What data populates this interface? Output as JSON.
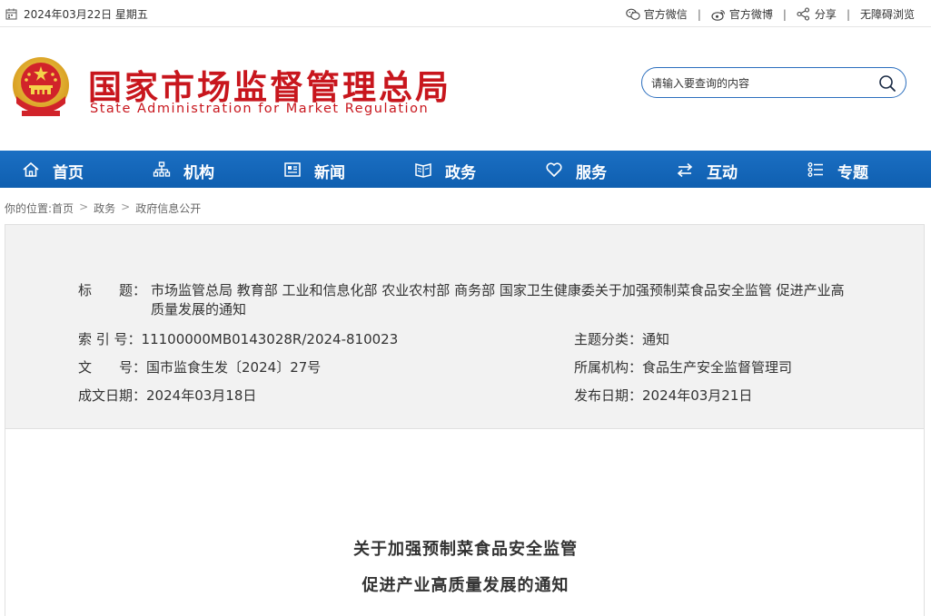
{
  "topbar": {
    "date": "2024年03月22日 星期五",
    "links": [
      {
        "label": "官方微信",
        "icon": "wechat-icon"
      },
      {
        "label": "官方微博",
        "icon": "weibo-icon"
      },
      {
        "label": "分享",
        "icon": "share-icon"
      },
      {
        "label": "无障碍浏览",
        "icon": ""
      }
    ],
    "separator": "|"
  },
  "header": {
    "title_cn": "国家市场监督管理总局",
    "title_en": "State Administration for Market Regulation",
    "search_placeholder": "请输入要查询的内容"
  },
  "nav": {
    "items": [
      {
        "label": "首页",
        "icon": "home-icon"
      },
      {
        "label": "机构",
        "icon": "org-chart-icon"
      },
      {
        "label": "新闻",
        "icon": "newspaper-icon"
      },
      {
        "label": "政务",
        "icon": "book-icon"
      },
      {
        "label": "服务",
        "icon": "heart-icon"
      },
      {
        "label": "互动",
        "icon": "exchange-icon"
      },
      {
        "label": "专题",
        "icon": "topic-list-icon"
      }
    ]
  },
  "breadcrumb": {
    "prefix": "你的位置:",
    "items": [
      "首页",
      "政务",
      "政府信息公开"
    ]
  },
  "info": {
    "title_label": "标　　题：",
    "title_value": "市场监管总局 教育部 工业和信息化部 农业农村部 商务部 国家卫生健康委关于加强预制菜食品安全监管 促进产业高质量发展的通知",
    "index_label": "索 引 号：",
    "index_value": "11100000MB0143028R/2024-810023",
    "topic_label": "主题分类：",
    "topic_value": "通知",
    "doc_label": "文　　号：",
    "doc_value": "国市监食生发〔2024〕27号",
    "org_label": "所属机构：",
    "org_value": "食品生产安全监督管理司",
    "created_label": "成文日期：",
    "created_value": "2024年03月18日",
    "published_label": "发布日期：",
    "published_value": "2024年03月21日"
  },
  "content": {
    "title_line1": "关于加强预制菜食品安全监管",
    "title_line2": "促进产业高质量发展的通知"
  },
  "colors": {
    "brand_red": "#c8161d",
    "nav_blue": "#1566b9",
    "search_border": "#2c6fbe"
  }
}
